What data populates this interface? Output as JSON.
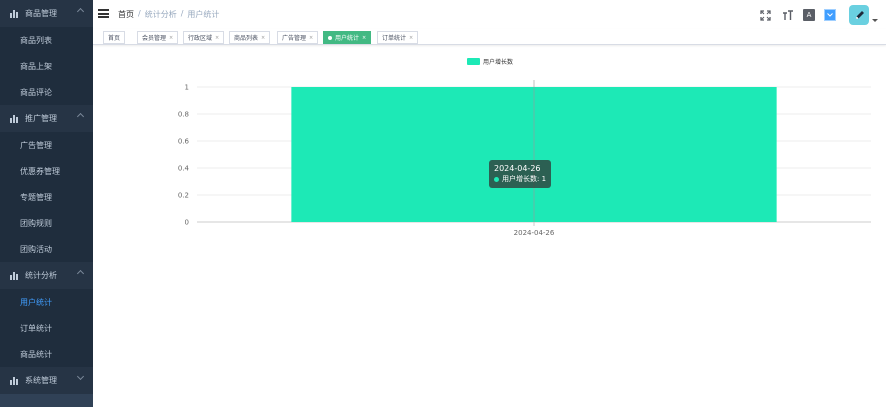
{
  "sidebar": {
    "groups": [
      {
        "label": "商品管理",
        "expanded": true,
        "items": [
          "商品列表",
          "商品上架",
          "商品评论"
        ]
      },
      {
        "label": "推广管理",
        "expanded": true,
        "items": [
          "广告管理",
          "优惠券管理",
          "专题管理",
          "团购规则",
          "团购活动"
        ]
      },
      {
        "label": "统计分析",
        "expanded": true,
        "items": [
          "用户统计",
          "订单统计",
          "商品统计"
        ]
      },
      {
        "label": "系统管理",
        "expanded": false,
        "items": []
      }
    ],
    "active_item": "用户统计"
  },
  "header": {
    "breadcrumb": [
      "首页",
      "统计分析",
      "用户统计"
    ],
    "separator": "/",
    "icons": [
      "fullscreen-icon",
      "text-size-icon",
      "translate-icon",
      "theme-icon",
      "avatar"
    ]
  },
  "tags": [
    {
      "label": "首页",
      "active": false
    },
    {
      "label": "会员管理",
      "active": false
    },
    {
      "label": "行政区域",
      "active": false
    },
    {
      "label": "商品列表",
      "active": false
    },
    {
      "label": "广告管理",
      "active": false
    },
    {
      "label": "用户统计",
      "active": true
    },
    {
      "label": "订单统计",
      "active": false
    }
  ],
  "chart_data": {
    "type": "bar",
    "categories": [
      "2024-04-26"
    ],
    "series": [
      {
        "name": "用户增长数",
        "values": [
          1
        ]
      }
    ],
    "ylim": [
      0,
      1
    ],
    "yticks": [
      "0",
      "0.2",
      "0.4",
      "0.6",
      "0.8",
      "1"
    ],
    "legend_position": "top-center",
    "grid": true,
    "color": "#1de9b6",
    "tooltip": {
      "title": "2024-04-26",
      "series": "用户增长数",
      "value": "1"
    }
  }
}
